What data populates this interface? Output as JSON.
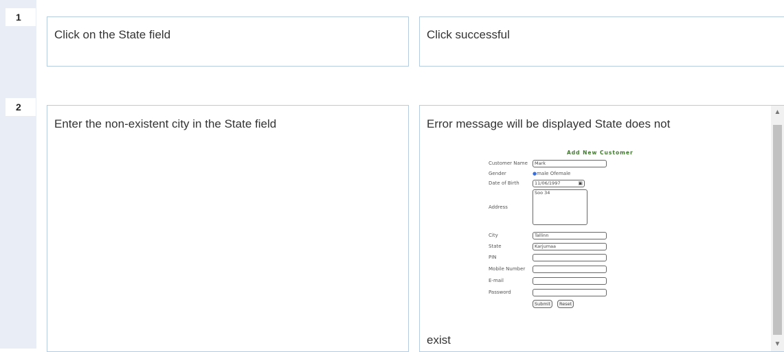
{
  "rows": [
    {
      "number": "1",
      "step": "Click on the State field",
      "expected": "Click successful"
    },
    {
      "number": "2",
      "step": "Enter the non-existent city in the State field",
      "expected_top": "Error message will be displayed State does not",
      "expected_bottom": "exist"
    }
  ],
  "form": {
    "title": "Add New Customer",
    "labels": {
      "customer_name": "Customer Name",
      "gender": "Gender",
      "dob": "Date of Birth",
      "address": "Address",
      "city": "City",
      "state": "State",
      "pin": "PIN",
      "mobile": "Mobile Number",
      "email": "E-mail",
      "password": "Password"
    },
    "values": {
      "customer_name": "Mark",
      "gender_options": "male Ofemale",
      "dob": "11/06/1997",
      "address": "Soo 34",
      "city": "Tallinn",
      "state": "Karjumaa"
    },
    "buttons": {
      "submit": "Submit",
      "reset": "Reset"
    }
  }
}
